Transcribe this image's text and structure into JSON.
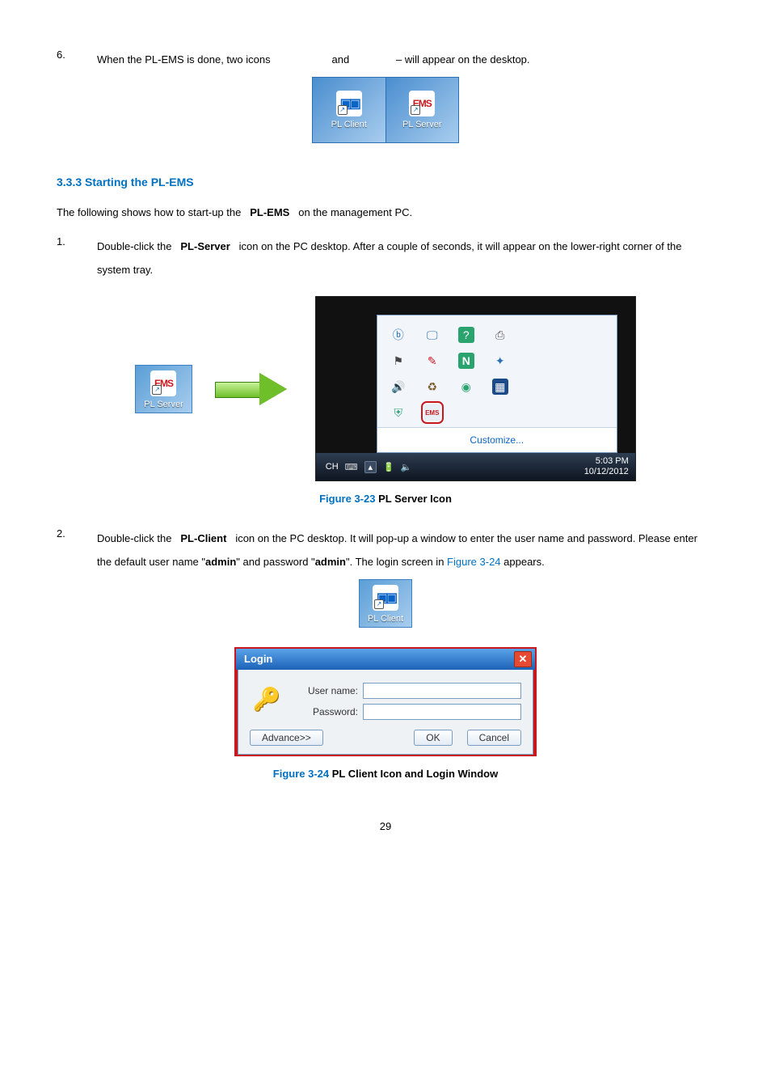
{
  "step6": {
    "num": "6.",
    "text_a": "When the PL-EMS is done, two icons",
    "text_b": "and",
    "text_c": "– will appear on the desktop."
  },
  "desktop_icons": {
    "left_label": "PL Client",
    "right_label": "PL Server",
    "ems_text": "EMS"
  },
  "section_title": "3.3.3 Starting the PL-EMS",
  "intro": {
    "a": "The following shows how to start-up the",
    "b": "PL-EMS",
    "c": "on the management PC."
  },
  "step1": {
    "num": "1.",
    "a": "Double-click the",
    "b": "PL-Server",
    "c": "icon on the PC desktop. After a couple of seconds, it will appear on the lower-right corner of the system tray."
  },
  "tray": {
    "customize": "Customize...",
    "lang": "CH",
    "time": "5:03 PM",
    "date": "10/12/2012"
  },
  "fig23": {
    "num": "Figure 3-23",
    "label": " PL Server Icon"
  },
  "step2": {
    "num": "2.",
    "a": "Double-click the",
    "b": "PL-Client",
    "c": "icon on the PC desktop. It will pop-up a window to enter the user name and password. Please enter the default user name \"",
    "d": "admin",
    "e": "\" and password \"",
    "f": "admin",
    "g": "\". The login screen in ",
    "h": "Figure 3-24",
    "i": " appears."
  },
  "login": {
    "title": "Login",
    "user_label": "User name:",
    "pass_label": "Password:",
    "advance": "Advance>>",
    "ok": "OK",
    "cancel": "Cancel"
  },
  "fig24": {
    "num": "Figure 3-24",
    "label": " PL Client Icon and Login Window"
  },
  "pagenum": "29"
}
